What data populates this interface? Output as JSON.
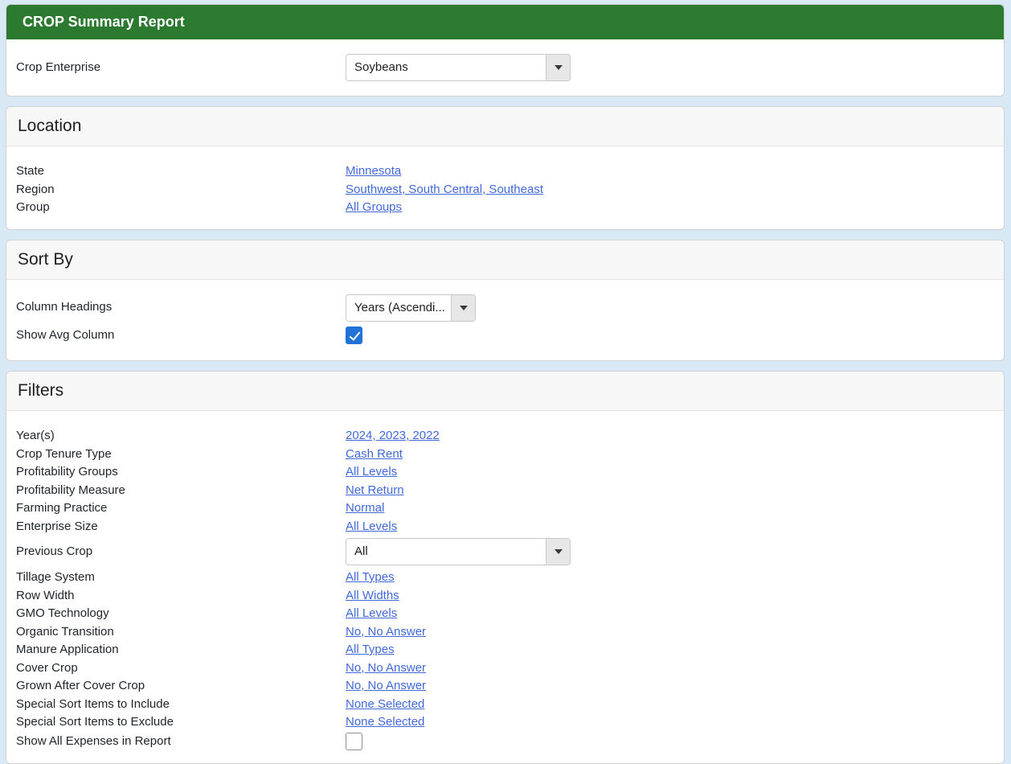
{
  "colors": {
    "page_bg": "#d9e8f5",
    "header_green": "#2b7a2f",
    "link_blue": "#4169d9",
    "checkbox_blue": "#2273d8",
    "panel_header_bg": "#f7f7f7"
  },
  "report": {
    "title": "CROP Summary Report"
  },
  "crop_enterprise": {
    "label": "Crop Enterprise",
    "value": "Soybeans"
  },
  "location": {
    "title": "Location",
    "rows": [
      {
        "label": "State",
        "value": "Minnesota"
      },
      {
        "label": "Region",
        "value": "Southwest, South Central, Southeast"
      },
      {
        "label": "Group",
        "value": "All Groups"
      }
    ]
  },
  "sort_by": {
    "title": "Sort By",
    "column_headings_label": "Column Headings",
    "column_headings_value": "Years (Ascendi...",
    "show_avg_label": "Show Avg Column",
    "show_avg_checked": true
  },
  "filters": {
    "title": "Filters",
    "rows_top": [
      {
        "label": "Year(s)",
        "value": "2024, 2023, 2022"
      },
      {
        "label": "Crop Tenure Type",
        "value": "Cash Rent"
      },
      {
        "label": "Profitability Groups",
        "value": "All Levels"
      },
      {
        "label": "Profitability Measure",
        "value": "Net Return"
      },
      {
        "label": "Farming Practice",
        "value": "Normal"
      },
      {
        "label": "Enterprise Size",
        "value": "All Levels"
      }
    ],
    "previous_crop_label": "Previous Crop",
    "previous_crop_value": "All",
    "rows_bottom": [
      {
        "label": "Tillage System",
        "value": "All Types"
      },
      {
        "label": "Row Width",
        "value": "All Widths"
      },
      {
        "label": "GMO Technology",
        "value": "All Levels"
      },
      {
        "label": "Organic Transition",
        "value": "No, No Answer"
      },
      {
        "label": "Manure Application",
        "value": "All Types"
      },
      {
        "label": "Cover Crop",
        "value": "No, No Answer"
      },
      {
        "label": "Grown After Cover Crop",
        "value": "No, No Answer"
      },
      {
        "label": "Special Sort Items to Include",
        "value": "None Selected"
      },
      {
        "label": "Special Sort Items to Exclude",
        "value": "None Selected"
      }
    ],
    "show_all_expenses_label": "Show All Expenses in Report",
    "show_all_expenses_checked": false
  }
}
